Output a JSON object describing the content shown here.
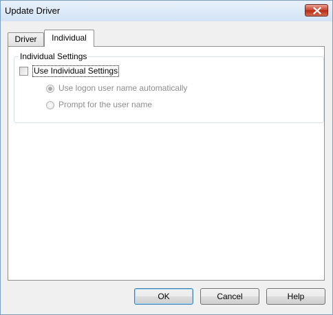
{
  "window": {
    "title": "Update Driver",
    "accent": "#c7402d"
  },
  "tabs": [
    {
      "label": "Driver",
      "selected": false
    },
    {
      "label": "Individual",
      "selected": true
    }
  ],
  "group": {
    "label": "Individual Settings",
    "checkbox": {
      "label": "Use Individual Settings",
      "checked": false
    },
    "radios": [
      {
        "label": "Use logon user name automatically",
        "selected": true,
        "enabled": false
      },
      {
        "label": "Prompt for the user name",
        "selected": false,
        "enabled": false
      }
    ]
  },
  "buttons": {
    "ok": "OK",
    "cancel": "Cancel",
    "help": "Help"
  },
  "icons": {
    "close": "close-icon"
  }
}
